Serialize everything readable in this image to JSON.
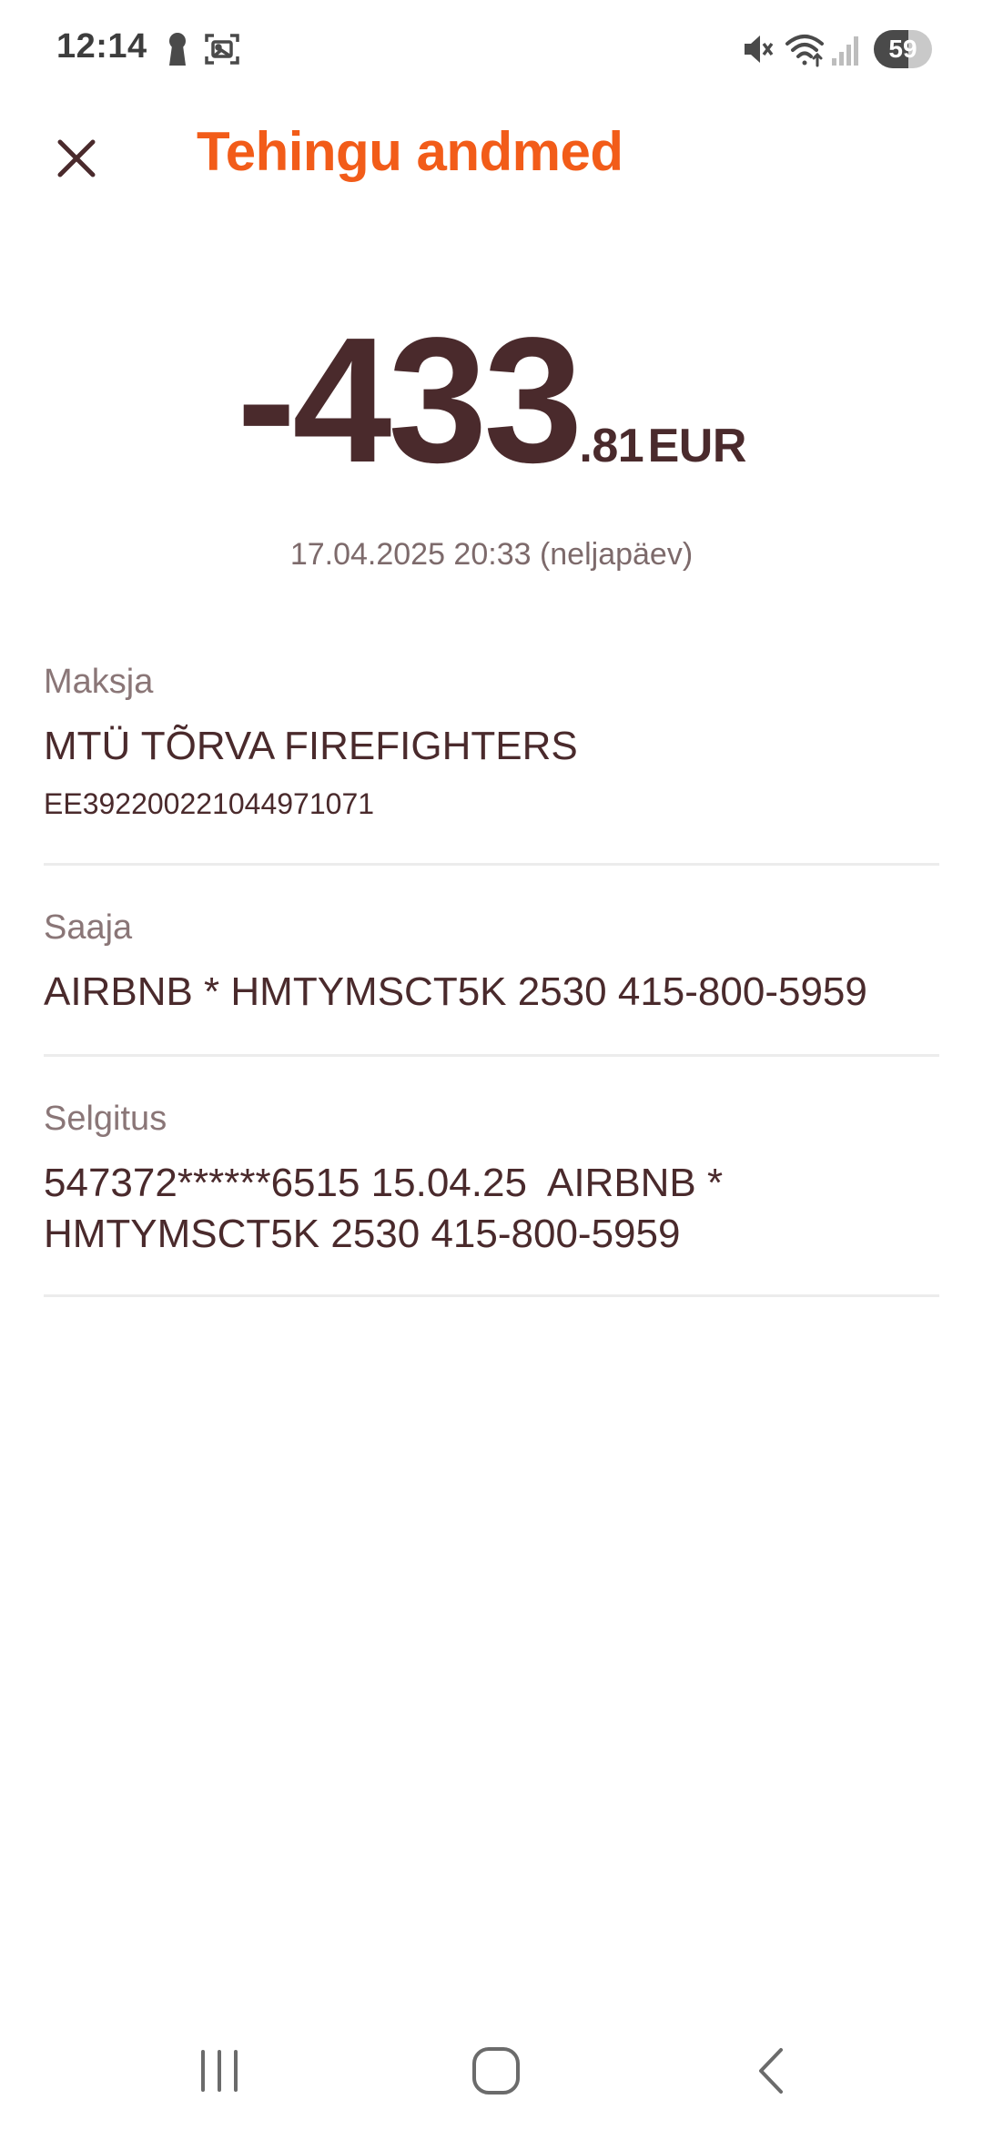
{
  "status_bar": {
    "time": "12:14",
    "battery_level": "59",
    "battery_fraction": 0.59,
    "left_icons": [
      "keyhole-icon",
      "screenshot-icon"
    ],
    "right_icons": [
      "mute-icon",
      "wifi-icon",
      "signal-icon",
      "battery-icon"
    ]
  },
  "header": {
    "title": "Tehingu andmed",
    "close_icon": "close-icon",
    "accent_color": "#f25c19"
  },
  "transaction": {
    "amount_int": "-433",
    "amount_dec": ".81",
    "currency": "EUR",
    "date": "17.04.2025 20:33 (neljapäev)"
  },
  "payer": {
    "label": "Maksja",
    "name": "MTÜ TÕRVA FIREFIGHTERS",
    "iban": "EE392200221044971071"
  },
  "recipient": {
    "label": "Saaja",
    "name": "AIRBNB * HMTYMSCT5K 2530 415-800-5959"
  },
  "description": {
    "label": "Selgitus",
    "line1": "547372******6515 15.04.25  AIRBNB *",
    "line2": "HMTYMSCT5K 2530 415-800-5959"
  },
  "nav": {
    "icons": [
      "recent-apps-icon",
      "home-icon",
      "back-icon"
    ]
  },
  "colors": {
    "text_primary": "#4a2a2c",
    "text_secondary": "#8a7677",
    "divider": "#ececec"
  }
}
